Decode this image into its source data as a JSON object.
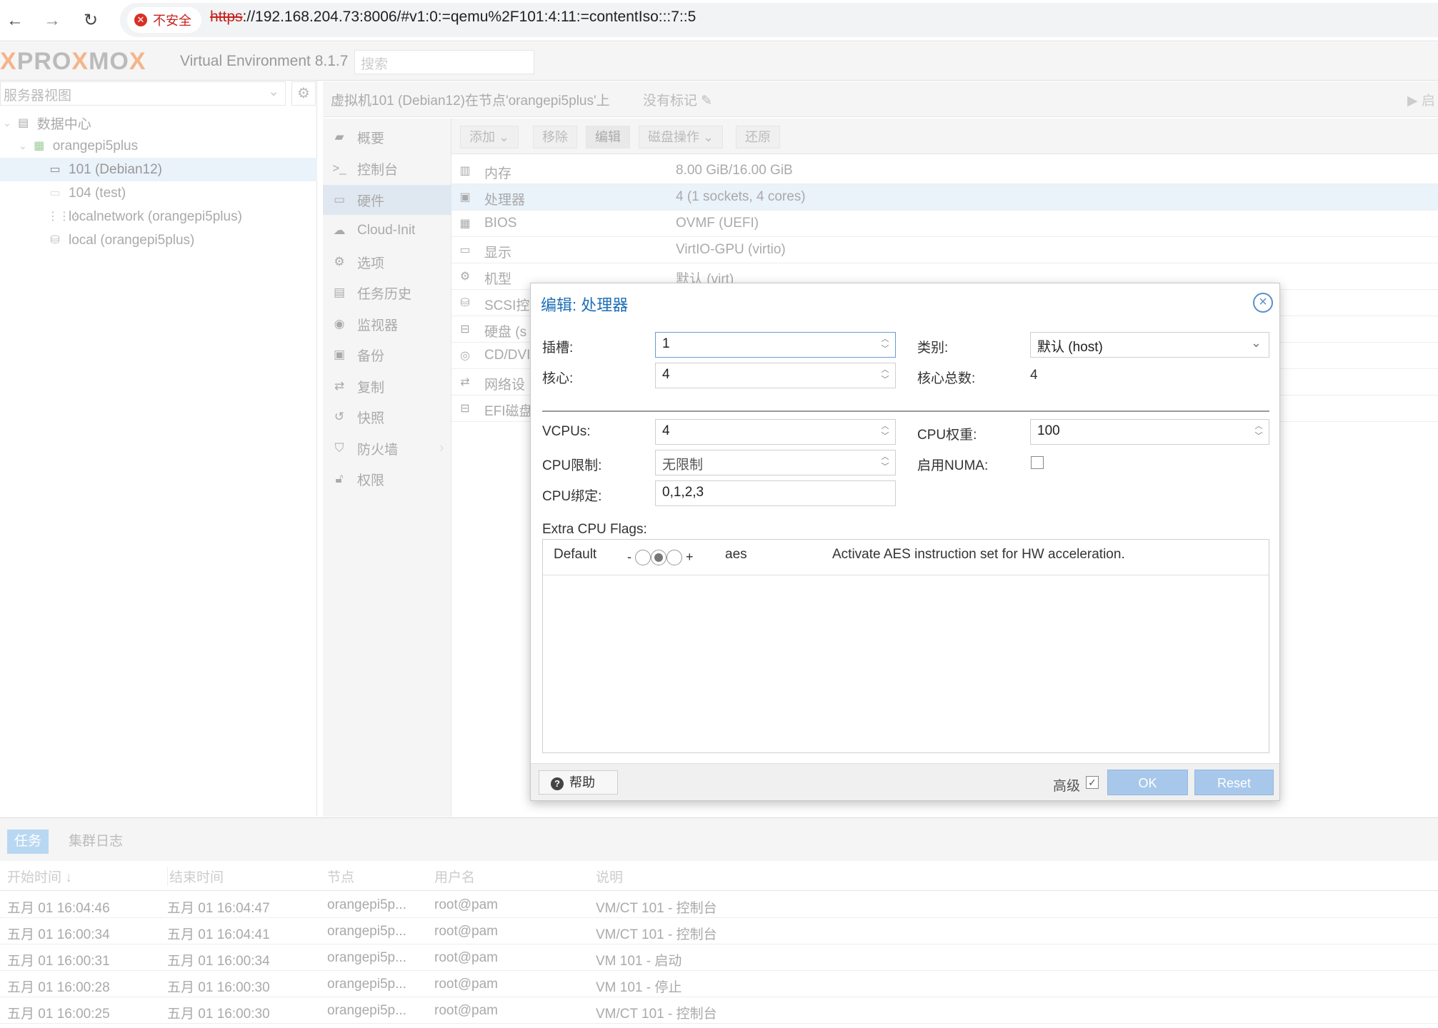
{
  "browser": {
    "insecure_label": "不安全",
    "url_scheme": "https",
    "url_rest": "://192.168.204.73:8006/#v1:0:=qemu%2F101:4:11:=contentIso:::7::5"
  },
  "header": {
    "logo_text_a": "PRO",
    "logo_text_b": "MO",
    "version": "Virtual Environment 8.1.7",
    "search_placeholder": "搜索"
  },
  "left": {
    "view_selector": "服务器视图",
    "tree": [
      {
        "label": "数据中心",
        "icon": "datacenter-icon"
      },
      {
        "label": "orangepi5plus",
        "icon": "node-icon"
      },
      {
        "label": "101 (Debian12)",
        "icon": "vm-running-icon"
      },
      {
        "label": "104 (test)",
        "icon": "vm-icon"
      },
      {
        "label": "localnetwork (orangepi5plus)",
        "icon": "network-icon"
      },
      {
        "label": "local (orangepi5plus)",
        "icon": "storage-icon"
      }
    ]
  },
  "center": {
    "title": "虚拟机101 (Debian12)在节点'orangepi5plus'上",
    "tags": "没有标记",
    "start_label": "启",
    "menu": [
      "概要",
      "控制台",
      "硬件",
      "Cloud-Init",
      "选项",
      "任务历史",
      "监视器",
      "备份",
      "复制",
      "快照",
      "防火墙",
      "权限"
    ],
    "toolbar": [
      "添加",
      "移除",
      "编辑",
      "磁盘操作",
      "还原"
    ],
    "hardware": [
      {
        "name": "内存",
        "value": "8.00 GiB/16.00 GiB"
      },
      {
        "name": "处理器",
        "value": "4 (1 sockets, 4 cores)"
      },
      {
        "name": "BIOS",
        "value": "OVMF (UEFI)"
      },
      {
        "name": "显示",
        "value": "VirtIO-GPU (virtio)"
      },
      {
        "name": "机型",
        "value": "默认 (virt)"
      },
      {
        "name": "SCSI控",
        "value": ""
      },
      {
        "name": "硬盘 (s",
        "value": ""
      },
      {
        "name": "CD/DVI",
        "value": ""
      },
      {
        "name": "网络设",
        "value": ""
      },
      {
        "name": "EFI磁盘",
        "value": ""
      }
    ]
  },
  "dialog": {
    "title": "编辑: 处理器",
    "sockets_label": "插槽:",
    "sockets_value": "1",
    "cores_label": "核心:",
    "cores_value": "4",
    "type_label": "类别:",
    "type_value": "默认 (host)",
    "total_cores_label": "核心总数:",
    "total_cores_value": "4",
    "vcpus_label": "VCPUs:",
    "vcpus_value": "4",
    "cpuunits_label": "CPU权重:",
    "cpuunits_value": "100",
    "cpulimit_label": "CPU限制:",
    "cpulimit_value": "无限制",
    "numa_label": "启用NUMA:",
    "affinity_label": "CPU绑定:",
    "affinity_value": "0,1,2,3",
    "flags_label": "Extra CPU Flags:",
    "flag_row": {
      "state": "Default",
      "minus": "-",
      "plus": "+",
      "flag": "aes",
      "desc": "Activate AES instruction set for HW acceleration."
    },
    "help_label": "帮助",
    "advanced_label": "高级",
    "ok_label": "OK",
    "reset_label": "Reset"
  },
  "tasks": {
    "tabs": [
      "任务",
      "集群日志"
    ],
    "columns": [
      "开始时间 ↓",
      "结束时间",
      "节点",
      "用户名",
      "说明"
    ],
    "rows": [
      [
        "五月 01 16:04:46",
        "五月 01 16:04:47",
        "orangepi5p...",
        "root@pam",
        "VM/CT 101 - 控制台"
      ],
      [
        "五月 01 16:00:34",
        "五月 01 16:04:41",
        "orangepi5p...",
        "root@pam",
        "VM/CT 101 - 控制台"
      ],
      [
        "五月 01 16:00:31",
        "五月 01 16:00:34",
        "orangepi5p...",
        "root@pam",
        "VM 101 - 启动"
      ],
      [
        "五月 01 16:00:28",
        "五月 01 16:00:30",
        "orangepi5p...",
        "root@pam",
        "VM 101 - 停止"
      ],
      [
        "五月 01 16:00:25",
        "五月 01 16:00:30",
        "orangepi5p...",
        "root@pam",
        "VM/CT 101 - 控制台"
      ]
    ]
  }
}
